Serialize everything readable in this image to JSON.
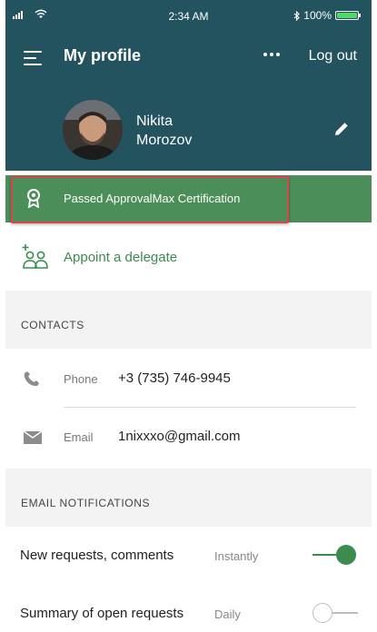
{
  "status_bar": {
    "time": "2:34 AM",
    "battery": "100%"
  },
  "header": {
    "title": "My profile",
    "logout_label": "Log out",
    "user_first_name": "Nikita",
    "user_last_name": "Morozov"
  },
  "certification": {
    "label": "Passed ApprovalMax Certification"
  },
  "delegate": {
    "label": "Appoint a delegate"
  },
  "contacts": {
    "section_title": "CONTACTS",
    "phone_label": "Phone",
    "phone_value": "+3 (735) 746-9945",
    "email_label": "Email",
    "email_value": "1nixxxo@gmail.com"
  },
  "notifications": {
    "section_title": "EMAIL NOTIFICATIONS",
    "items": [
      {
        "label": "New requests, comments",
        "frequency": "Instantly",
        "enabled": true
      },
      {
        "label": "Summary of open requests",
        "frequency": "Daily",
        "enabled": false
      }
    ]
  },
  "colors": {
    "header_bg": "#23535e",
    "cert_bg": "#4c8e59",
    "accent_green": "#3c8b4f",
    "highlight_border": "#d6474c"
  },
  "icons": {
    "menu": "hamburger-menu-icon",
    "more": "more-dots-icon",
    "edit": "pencil-icon",
    "cert": "award-badge-icon",
    "delegate": "add-user-group-icon",
    "phone": "phone-icon",
    "email": "envelope-icon"
  }
}
